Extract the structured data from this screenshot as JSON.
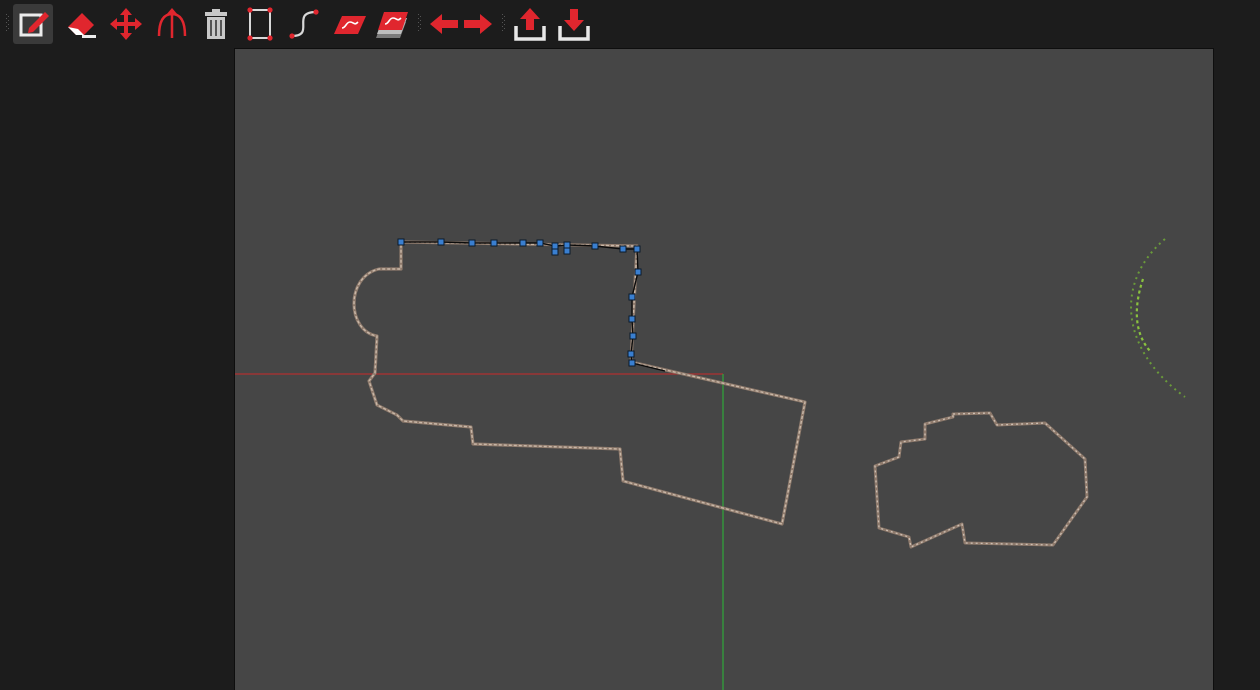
{
  "toolbar": {
    "tools": [
      {
        "name": "draw-polygon",
        "icon": "edit-icon",
        "active": true
      },
      {
        "name": "erase",
        "icon": "eraser-icon",
        "active": false
      },
      {
        "name": "move",
        "icon": "move-arrows-icon",
        "active": false
      },
      {
        "name": "split",
        "icon": "split-arrow-icon",
        "active": false
      },
      {
        "name": "delete",
        "icon": "trash-icon",
        "active": false
      },
      {
        "name": "rectangle",
        "icon": "rectangle-icon",
        "active": false
      },
      {
        "name": "curve",
        "icon": "curve-icon",
        "active": false
      },
      {
        "name": "layer",
        "icon": "layer-icon",
        "active": false
      },
      {
        "name": "layers-stack",
        "icon": "layers-stack-icon",
        "active": false
      },
      {
        "name": "previous",
        "icon": "arrow-left-icon",
        "active": false
      },
      {
        "name": "next",
        "icon": "arrow-right-icon",
        "active": false
      },
      {
        "name": "upload",
        "icon": "upload-icon",
        "active": false
      },
      {
        "name": "download",
        "icon": "download-icon",
        "active": false
      }
    ]
  },
  "colors": {
    "accent": "#e0262e",
    "background": "#1c1c1c",
    "viewport": "#464646",
    "x_axis": "#b03030",
    "y_axis": "#2fa83a",
    "vertex": "#3a7fd0",
    "point_cloud": "#b0988a"
  }
}
